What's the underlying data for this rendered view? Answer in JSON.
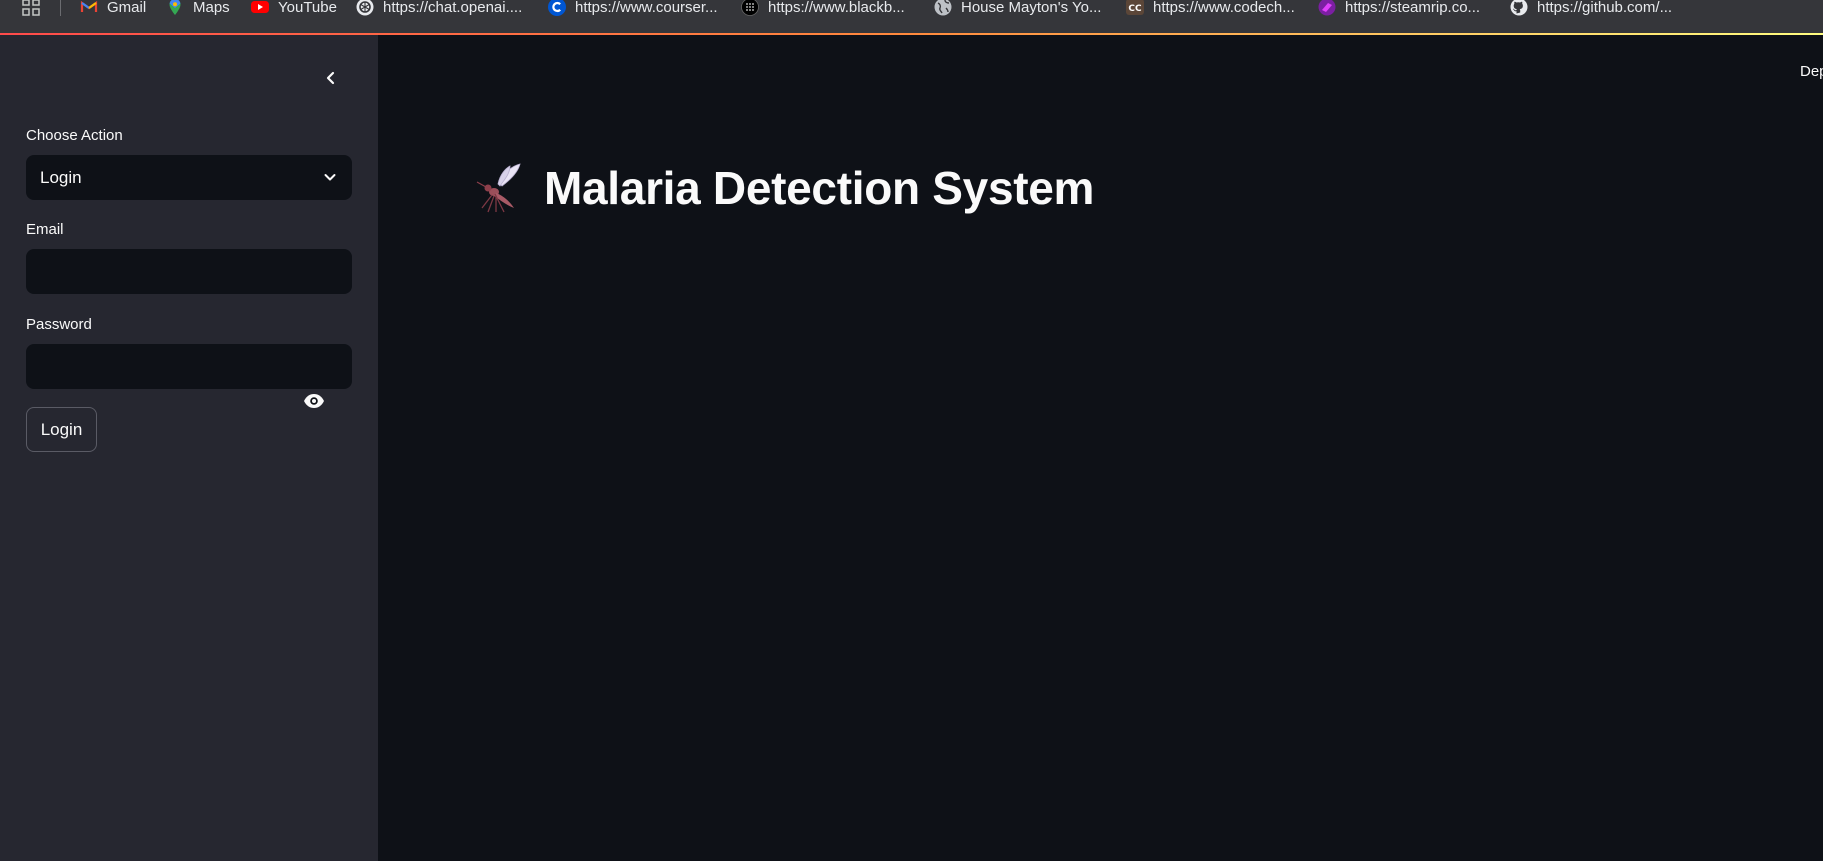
{
  "bookmarks_bar": {
    "items": [
      {
        "label": "Gmail",
        "icon": "gmail-icon"
      },
      {
        "label": "Maps",
        "icon": "maps-icon"
      },
      {
        "label": "YouTube",
        "icon": "youtube-icon"
      },
      {
        "label": "https://chat.openai....",
        "icon": "openai-icon"
      },
      {
        "label": "https://www.courser...",
        "icon": "coursera-icon"
      },
      {
        "label": "https://www.blackb...",
        "icon": "blackbox-icon"
      },
      {
        "label": "House Mayton's Yo...",
        "icon": "globe-icon"
      },
      {
        "label": "https://www.codech...",
        "icon": "codechef-icon"
      },
      {
        "label": "https://steamrip.co...",
        "icon": "steamrip-icon"
      },
      {
        "label": "https://github.com/...",
        "icon": "github-icon"
      }
    ]
  },
  "sidebar": {
    "choose_action_label": "Choose Action",
    "selected_action": "Login",
    "email_label": "Email",
    "email_value": "",
    "password_label": "Password",
    "password_value": "",
    "login_button": "Login"
  },
  "main": {
    "deploy_label": "Dep",
    "title": "Malaria Detection System"
  },
  "colors": {
    "sidebar_bg": "#262730",
    "main_bg": "#0e1117",
    "input_bg": "#0e1117",
    "text": "#fafafa",
    "bookmarks_bg": "#35363a"
  }
}
